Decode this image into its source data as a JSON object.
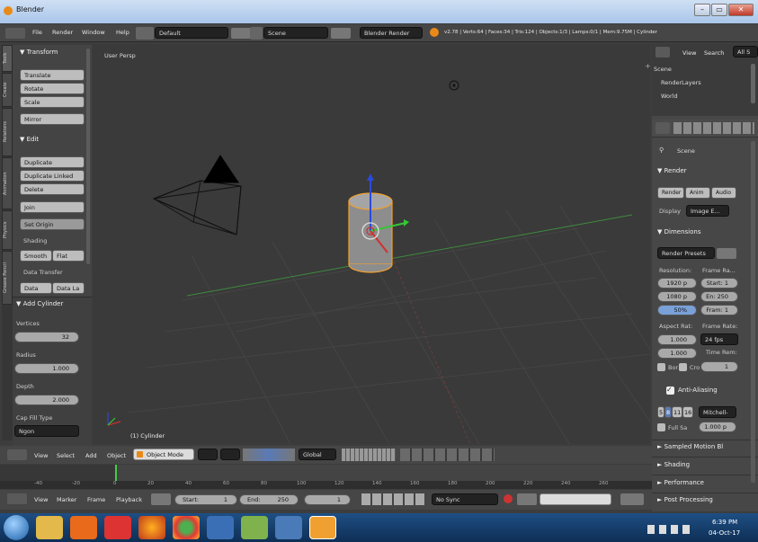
{
  "window": {
    "title": "Blender"
  },
  "menu": {
    "file": "File",
    "render": "Render",
    "window": "Window",
    "help": "Help"
  },
  "header": {
    "layout": "Default",
    "scene": "Scene",
    "engine": "Blender Render",
    "stats": "v2.78 | Verts:64 | Faces:34 | Tris:124 | Objects:1/3 | Lamps:0/1 | Mem:9.75M | Cylinder"
  },
  "lefttabs": [
    "Tools",
    "Create",
    "Relations",
    "Animation",
    "Physics",
    "Grease Pencil"
  ],
  "tools": {
    "transform_header": "▼ Transform",
    "translate": "Translate",
    "rotate": "Rotate",
    "scale": "Scale",
    "mirror": "Mirror",
    "edit_header": "▼ Edit",
    "duplicate": "Duplicate",
    "duplicate_linked": "Duplicate Linked",
    "delete": "Delete",
    "join": "Join",
    "set_origin": "Set Origin",
    "shading_label": "Shading",
    "smooth": "Smooth",
    "flat": "Flat",
    "data_transfer_label": "Data Transfer",
    "data": "Data",
    "data_la": "Data La"
  },
  "operator": {
    "header": "▼ Add Cylinder",
    "vertices_label": "Vertices",
    "vertices": "32",
    "radius_label": "Radius",
    "radius": "1.000",
    "depth_label": "Depth",
    "depth": "2.000",
    "cap_fill_label": "Cap Fill Type",
    "cap_fill": "Ngon"
  },
  "viewport": {
    "mode_label": "User Persp",
    "object_label": "(1) Cylinder"
  },
  "vpheader": {
    "view": "View",
    "select": "Select",
    "add": "Add",
    "object": "Object",
    "mode": "Object Mode",
    "orientation": "Global"
  },
  "timeline": {
    "ticks": [
      "-40",
      "-20",
      "0",
      "20",
      "40",
      "60",
      "80",
      "100",
      "120",
      "140",
      "160",
      "180",
      "200",
      "220",
      "240",
      "260"
    ]
  },
  "tlheader": {
    "view": "View",
    "marker": "Marker",
    "frame": "Frame",
    "playback": "Playback",
    "start": "Start:",
    "start_val": "1",
    "end": "End:",
    "end_val": "250",
    "current": "1",
    "sync": "No Sync"
  },
  "outliner": {
    "view": "View",
    "search": "Search",
    "all": "All S",
    "scene": "Scene",
    "renderlayers": "RenderLayers",
    "world": "World"
  },
  "props": {
    "scene": "Scene",
    "render_header": "▼ Render",
    "render_btn": "Render",
    "anim_btn": "Anim",
    "audio_btn": "Audio",
    "display_label": "Display",
    "display_val": "Image E...",
    "dimensions_header": "▼ Dimensions",
    "render_presets": "Render Presets",
    "resolution_label": "Resolution:",
    "frame_range_label": "Frame Ra...",
    "res_x": "1920 p",
    "res_y": "1080 p",
    "res_pct": "50%",
    "start_frame": "Start: 1",
    "end_frame": "En: 250",
    "frame_step": "Fram: 1",
    "aspect_label": "Aspect Rat:",
    "frame_rate_label": "Frame Rate:",
    "aspect_x": "1.000",
    "aspect_y": "1.000",
    "fps": "24 fps",
    "time_rem": "Time Rem:",
    "time_val": "1",
    "border_label": "Bor",
    "crop_label": "Cro",
    "aa_header": "Anti-Aliasing",
    "aa_5": "5",
    "aa_8": "8",
    "aa_11": "11",
    "aa_16": "16",
    "aa_filter": "Mitchell-",
    "aa_size": "1.000 p",
    "full_sample": "Full Sa",
    "sampled_motion": "► Sampled Motion Bl",
    "shading": "► Shading",
    "performance": "► Performance",
    "post_processing": "► Post Processing"
  },
  "taskbar": {
    "time": "6:39 PM",
    "date": "04-Oct-17"
  }
}
